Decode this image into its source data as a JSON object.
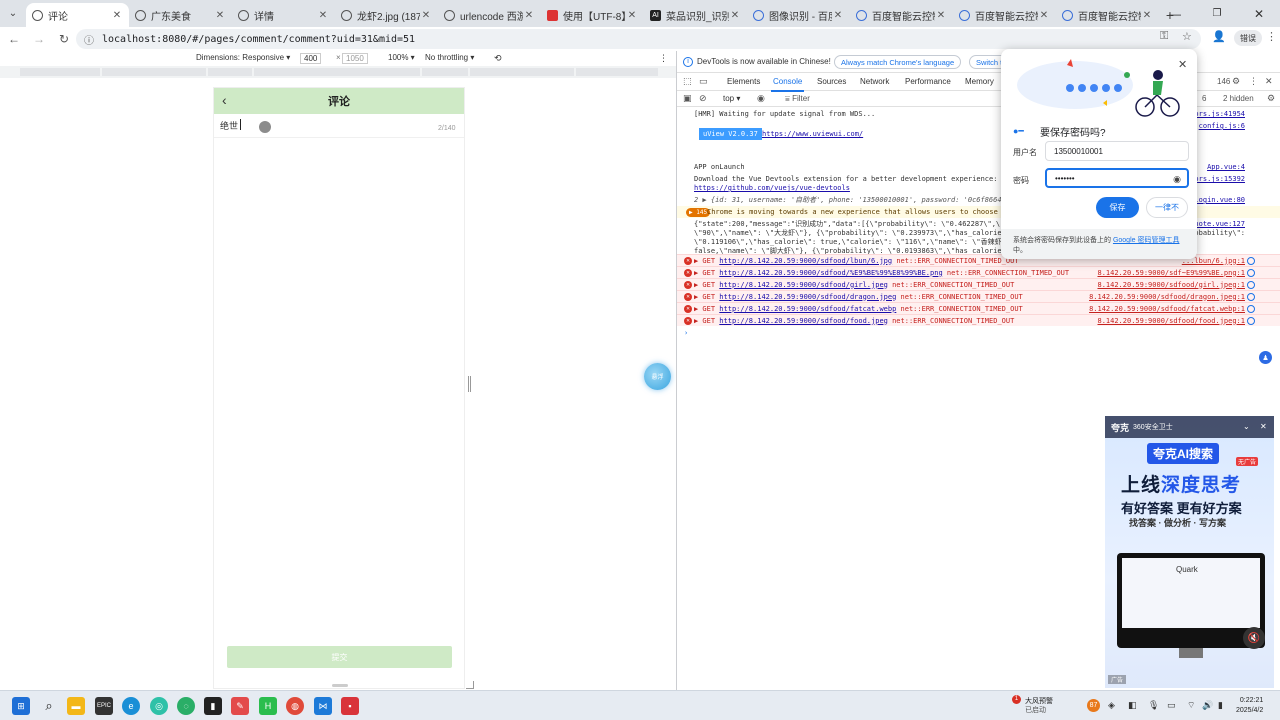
{
  "browser": {
    "tabs": [
      {
        "title": "评论",
        "active": true,
        "icon": "globe-icon"
      },
      {
        "title": "广东美食",
        "icon": "globe-icon"
      },
      {
        "title": "详情",
        "icon": "globe-icon"
      },
      {
        "title": "龙虾2.jpg (1879...",
        "icon": "globe-icon"
      },
      {
        "title": "urlencode 西游...",
        "icon": "globe-icon"
      },
      {
        "title": "使用【UTF-8】...",
        "icon": "red-square-icon"
      },
      {
        "title": "菜品识别_识别...",
        "icon": "ai-icon"
      },
      {
        "title": "图像识别 - 百度...",
        "icon": "chrome-icon"
      },
      {
        "title": "百度智能云控制...",
        "icon": "chrome-icon"
      },
      {
        "title": "百度智能云控制...",
        "icon": "chrome-icon"
      },
      {
        "title": "百度智能云控制...",
        "icon": "chrome-icon"
      }
    ],
    "url": "localhost:8080/#/pages/comment/comment?uid=31&mid=51",
    "profile_label": "错误"
  },
  "device_toolbar": {
    "dimensions": "Dimensions: Responsive ▾",
    "width": "400",
    "times": "×",
    "height": "1050",
    "zoom": "100% ▾",
    "throttling": "No throttling ▾"
  },
  "mobile": {
    "title": "评论",
    "back_icon": "chevron-left-icon",
    "comment_text": "绝世",
    "counter": "2/140",
    "submit_label": "提交"
  },
  "float_ball_label": "悬浮",
  "devtools": {
    "notice": "DevTools is now available in Chinese!",
    "btn_match": "Always match Chrome's language",
    "btn_switch": "Switch t",
    "tabs": [
      "Elements",
      "Console",
      "Sources",
      "Network",
      "Performance",
      "Memory"
    ],
    "active_tab": "Console",
    "issue_count": "146",
    "context": "top ▾",
    "filter_placeholder": "Filter",
    "levels": "6",
    "hidden": "2 hidden",
    "console": {
      "hmr": "[HMR] Waiting for update signal from WDS...",
      "hmr_src": "vendors.js:41954",
      "config_src": "config.js:6",
      "uview_badge": "uView V2.0.37",
      "uview_link": "https://www.uviewui.com/",
      "launch": "APP onLaunch",
      "launch_src": "App.vue:4",
      "devtools_msg": "Download the Vue Devtools extension for a better development experience:",
      "devtools_link": "https://github.com/vuejs/vue-devtools",
      "devtools_src": "vendors.js:15392",
      "obj_line": "2  ▶ {id: 31, username: '自助者', phone: '13500010001', password: '0c6f86645...",
      "obj_src": "login.vue:80",
      "warn_badge": "▶ 145",
      "warn_text": "Chrome is moving towards a new experience that allows users to choose ...",
      "json1": "{\"state\":200,\"message\":\"识别成功\",\"data\":[{\\\"probability\\\": \\\"0.462287\\\",\\\"h...",
      "json1_src": "...e-note.vue:127",
      "json2": "\\\"90\\\",\\\"name\\\": \\\"大龙虾\\\"}, {\\\"probability\\\": \\\"0.239973\\\",\\\"has_calorie\\\":...",
      "json2_tail": "\\\"probability\\\":",
      "json3": "\\\"0.119106\\\",\\\"has_calorie\\\": true,\\\"calorie\\\": \\\"116\\\",\\\"name\\\": \\\"香辣虾\\\"}",
      "json4": "false,\\\"name\\\": \\\"脚大虾\\\"}, {\\\"probability\\\": \\\"0.0193863\\\",\\\"has_calorie\\\":...",
      "errors": [
        {
          "link": "http://8.142.20.59:9000/sdfood/lbun/6.jpg",
          "tail": "net::ERR_CONNECTION_TIMED_OUT",
          "src": "...lbun/6.jpg:1"
        },
        {
          "link": "http://8.142.20.59:9000/sdfood/%E9%BE%99%E8%99%BE.png",
          "tail": "net::ERR_CONNECTION_TIMED_OUT",
          "src": "8.142.20.59:9000/sdf~E9%99%BE.png:1"
        },
        {
          "link": "http://8.142.20.59:9000/sdfood/girl.jpeg",
          "tail": "net::ERR_CONNECTION_TIMED_OUT",
          "src": "8.142.20.59:9000/sdfood/girl.jpeg:1"
        },
        {
          "link": "http://8.142.20.59:9000/sdfood/dragon.jpeg",
          "tail": "net::ERR_CONNECTION_TIMED_OUT",
          "src": "8.142.20.59:9000/sdfood/dragon.jpeg:1"
        },
        {
          "link": "http://8.142.20.59:9000/sdfood/fatcat.webp",
          "tail": "net::ERR_CONNECTION_TIMED_OUT",
          "src": "8.142.20.59:9000/sdfood/fatcat.webp:1"
        },
        {
          "link": "http://8.142.20.59:9000/sdfood/food.jpeg",
          "tail": "net::ERR_CONNECTION_TIMED_OUT",
          "src": "8.142.20.59:9000/sdfood/food.jpeg:1"
        }
      ],
      "error_method": "▶ GET",
      "prompt": "›"
    }
  },
  "password_popup": {
    "title": "要保存密码吗?",
    "username_label": "用户名",
    "username_value": "13500010001",
    "password_label": "密码",
    "password_value": "•••••••",
    "save": "保存",
    "never": "一律不",
    "footer": "系统会将密码保存到此设备上的 ",
    "footer_link": "Google 密码管理工具",
    "footer_end": "中。"
  },
  "ad": {
    "brand": "夸克",
    "sub": "360安全卫士",
    "pill": "夸克AI搜索",
    "pill_tag": "无广告",
    "h1_a": "上线",
    "h1_b": "深度思考",
    "h2": "有好答案 更有好方案",
    "h3": "找答案 · 做分析 · 写方案",
    "screen_title": "Quark",
    "badge": "广告"
  },
  "taskbar": {
    "notif_title": "大风预警",
    "notif_sub": "已启动",
    "notif_count": "1",
    "tray_temp": "87",
    "time": "0:22:21",
    "date": "2025/4/2"
  }
}
